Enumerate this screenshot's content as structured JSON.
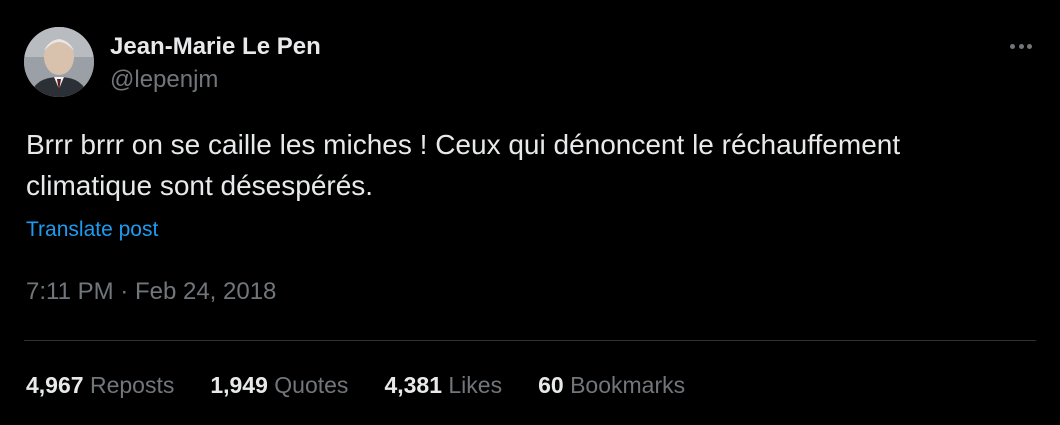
{
  "author": {
    "display_name": "Jean-Marie Le Pen",
    "handle": "@lepenjm",
    "avatar_icon": "profile-photo"
  },
  "menu": {
    "more_icon": "more-horizontal-icon"
  },
  "tweet": {
    "text": "Brrr brrr on se caille les miches ! Ceux qui dénoncent le réchauffement climatique sont désespérés.",
    "translate_label": "Translate post"
  },
  "meta": {
    "time": "7:11 PM",
    "separator": "·",
    "date": "Feb 24, 2018"
  },
  "stats": [
    {
      "count": "4,967",
      "label": "Reposts"
    },
    {
      "count": "1,949",
      "label": "Quotes"
    },
    {
      "count": "4,381",
      "label": "Likes"
    },
    {
      "count": "60",
      "label": "Bookmarks"
    }
  ],
  "colors": {
    "background": "#000000",
    "text": "#e7e9ea",
    "secondary": "#71767b",
    "link": "#1d9bf0",
    "divider": "#2f3336"
  }
}
